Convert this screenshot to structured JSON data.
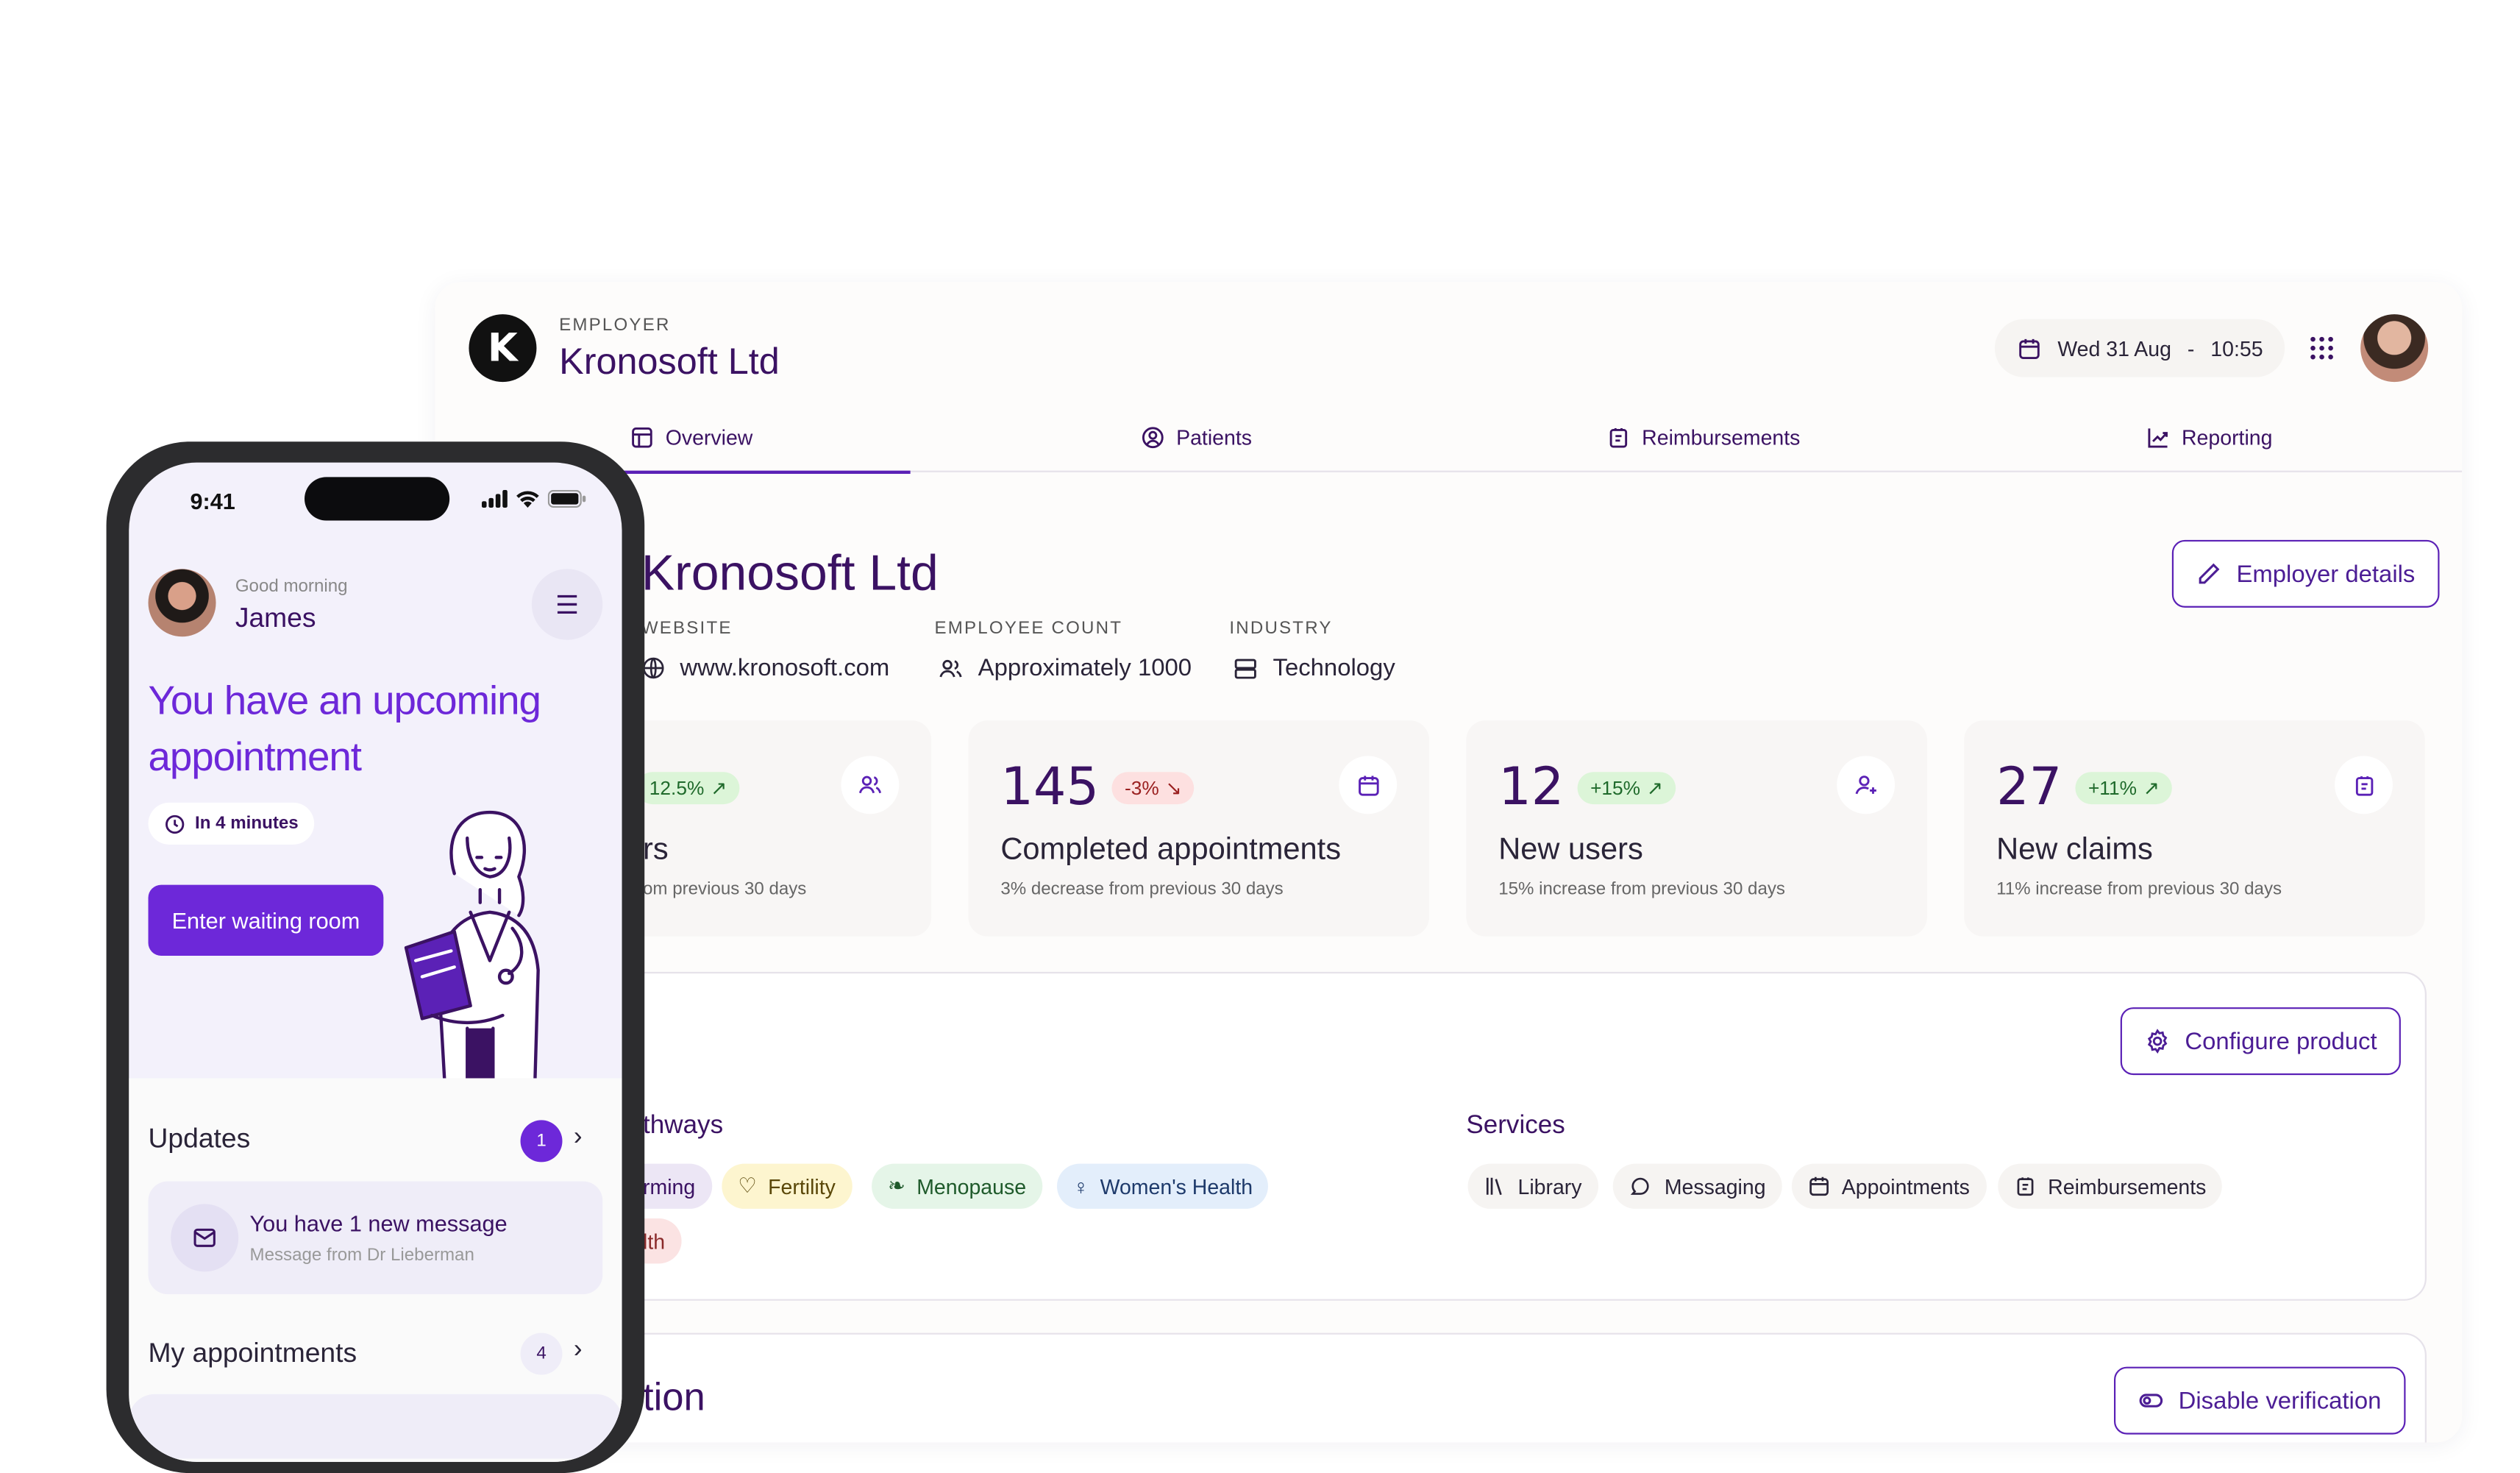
{
  "employer": {
    "label": "EMPLOYER",
    "name": "Kronosoft Ltd",
    "logo_letter": "K"
  },
  "header": {
    "date": "Wed 31 Aug",
    "sep": "-",
    "time": "10:55",
    "apps_icon": "grid-icon"
  },
  "tabs": [
    {
      "label": "Overview",
      "icon": "layout-icon",
      "active": true
    },
    {
      "label": "Patients",
      "icon": "user-circle-icon"
    },
    {
      "label": "Reimbursements",
      "icon": "receipt-icon"
    },
    {
      "label": "Reporting",
      "icon": "chart-line-icon"
    }
  ],
  "company": {
    "title": "Kronosoft Ltd",
    "details_button": "Employer details",
    "website_label": "WEBSITE",
    "website": "www.kronosoft.com",
    "count_label": "EMPLOYEE COUNT",
    "count": "Approximately 1000",
    "industry_label": "INDUSTRY",
    "industry": "Technology"
  },
  "stats": [
    {
      "value": "",
      "change": "12.5%",
      "dir": "up",
      "title": "rs",
      "sub": "om previous 30 days",
      "icon": "users-icon"
    },
    {
      "value": "145",
      "change": "-3%",
      "dir": "down",
      "title": "Completed appointments",
      "sub": "3% decrease from previous 30 days",
      "icon": "calendar-icon"
    },
    {
      "value": "12",
      "change": "+15%",
      "dir": "up",
      "title": "New users",
      "sub": "15% increase from previous 30 days",
      "icon": "user-plus-icon"
    },
    {
      "value": "27",
      "change": "+11%",
      "dir": "up",
      "title": "New claims",
      "sub": "11% increase from previous 30 days",
      "icon": "receipt-icon"
    }
  ],
  "product": {
    "configure_button": "Configure product",
    "pathways_title": "thways",
    "pathways": [
      "rming",
      "Fertility",
      "Menopause",
      "Women's Health",
      "lth"
    ],
    "services_title": "Services",
    "services": [
      "Library",
      "Messaging",
      "Appointments",
      "Reimbursements"
    ]
  },
  "verification": {
    "title": "tion",
    "button": "Disable verification"
  },
  "colors": {
    "accent": "#5b21b6",
    "brand_text": "#3b1263",
    "phone_accent": "#6d28d9"
  },
  "phone": {
    "time": "9:41",
    "greeting": "Good morning",
    "name": "James",
    "headline_1": "You have an upcoming",
    "headline_2": "appointment",
    "pill": "In 4 minutes",
    "cta": "Enter waiting room",
    "updates_title": "Updates",
    "updates_count": "1",
    "message_title": "You have 1 new message",
    "message_sub": "Message from Dr Lieberman",
    "appointments_title": "My appointments",
    "appointments_count": "4"
  }
}
